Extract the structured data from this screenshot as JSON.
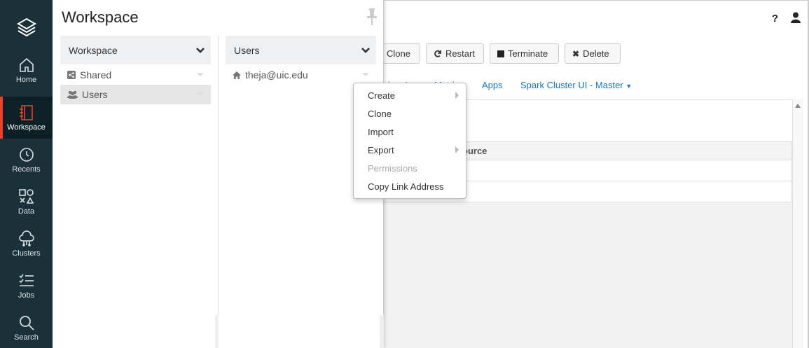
{
  "nav": {
    "items": [
      {
        "label": "Home",
        "icon": "home-icon"
      },
      {
        "label": "Workspace",
        "icon": "workspace-icon"
      },
      {
        "label": "Recents",
        "icon": "clock-icon"
      },
      {
        "label": "Data",
        "icon": "data-icon"
      },
      {
        "label": "Clusters",
        "icon": "cloud-icon"
      },
      {
        "label": "Jobs",
        "icon": "jobs-icon"
      },
      {
        "label": "Search",
        "icon": "search-icon"
      }
    ],
    "active": "Workspace",
    "accent": "#e8412d",
    "background": "#1b3139"
  },
  "workspace": {
    "title": "Workspace",
    "columns": [
      {
        "header": "Workspace",
        "items": [
          {
            "label": "Shared",
            "icon": "share-icon"
          },
          {
            "label": "Users",
            "icon": "users-icon",
            "selected": true
          }
        ]
      },
      {
        "header": "Users",
        "items": [
          {
            "label": "theja@uic.edu",
            "icon": "home-icon"
          }
        ]
      }
    ]
  },
  "context_menu": {
    "items": [
      {
        "label": "Create",
        "submenu": true,
        "disabled": false
      },
      {
        "label": "Clone",
        "submenu": false,
        "disabled": false
      },
      {
        "label": "Import",
        "submenu": false,
        "disabled": false
      },
      {
        "label": "Export",
        "submenu": true,
        "disabled": false
      },
      {
        "label": "Permissions",
        "submenu": false,
        "disabled": true
      },
      {
        "label": "Copy Link Address",
        "submenu": false,
        "disabled": false
      }
    ]
  },
  "cluster": {
    "buttons": {
      "clone": "Clone",
      "restart": "Restart",
      "terminate": "Terminate",
      "delete": "Delete"
    },
    "tabs": {
      "driver_logs": "Driver Logs",
      "metrics": "Metrics",
      "apps": "Apps",
      "spark_ui": "Spark Cluster UI - Master"
    },
    "table_header_partial": "ource"
  },
  "topbar": {
    "help": "?"
  },
  "link_color": "#1a73c2"
}
